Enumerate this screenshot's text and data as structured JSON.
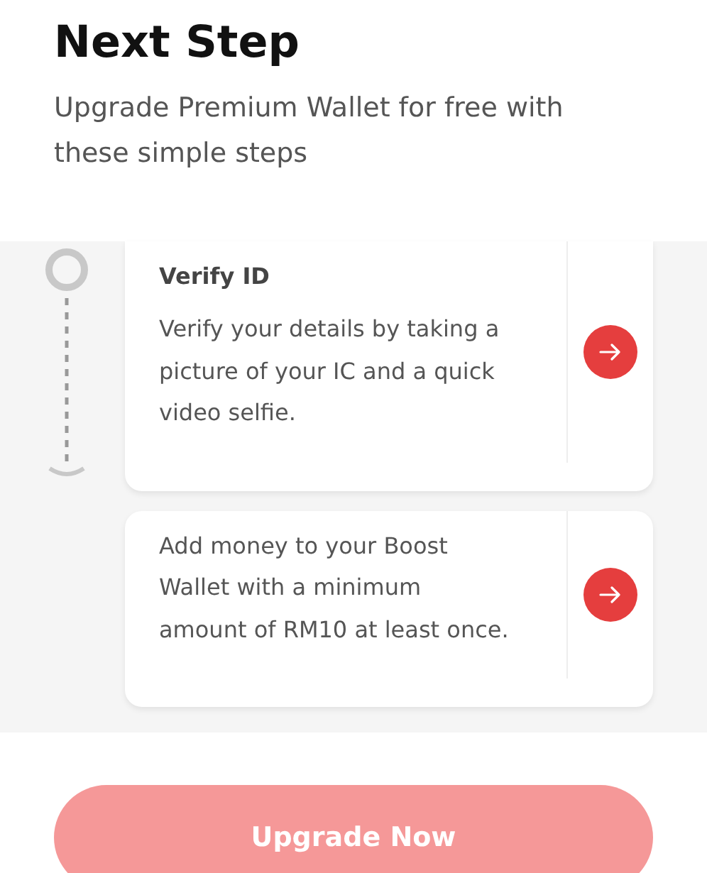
{
  "title": "Next Step",
  "subtitle": "Upgrade Premium Wallet for free with these simple steps",
  "steps": [
    {
      "title": "Verify ID",
      "description": "Verify your details by taking a picture of your IC and a quick video selfie."
    },
    {
      "description": "Add money to your Boost Wallet with a minimum amount of RM10 at least once."
    }
  ],
  "button": {
    "label": "Upgrade Now",
    "disabled": true
  }
}
